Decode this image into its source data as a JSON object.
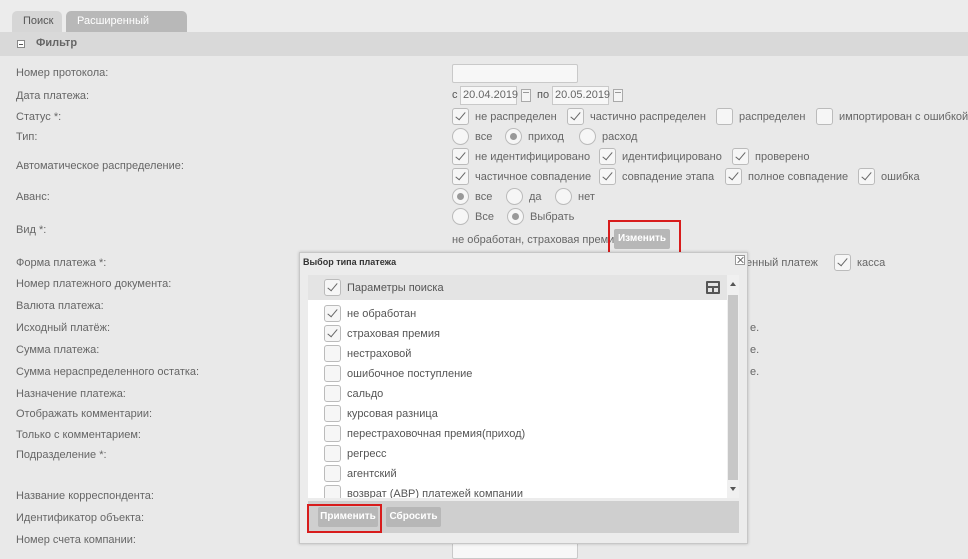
{
  "tabs": [
    "Поиск",
    "Расширенный поиск"
  ],
  "filter_title": "Фильтр",
  "labels": [
    "Номер протокола:",
    "Дата платежа:",
    "Статус *:",
    "Тип:",
    "Автоматическое распределение:",
    "Аванс:",
    "Вид *:",
    "Форма платежа *:",
    "Номер платежного документа:",
    "Валюта платежа:",
    "Исходный платёж:",
    "Сумма платежа:",
    "Сумма нераспределенного остатка:",
    "Назначение платежа:",
    "Отображать комментарии:",
    "Только с комментарием:",
    "Подразделение *:",
    "Название корреспондента:",
    "Идентификатор объекта:",
    "Номер счета компании:"
  ],
  "date": {
    "from_prefix": "с",
    "from": "20.04.2019",
    "to_prefix": "по",
    "to": "20.05.2019"
  },
  "status_options": [
    {
      "label": "не распределен",
      "checked": true
    },
    {
      "label": "частично распределен",
      "checked": true
    },
    {
      "label": "распределен",
      "checked": false
    },
    {
      "label": "импортирован с ошибкой",
      "checked": false
    }
  ],
  "type_options": [
    {
      "label": "все",
      "selected": false
    },
    {
      "label": "приход",
      "selected": true
    },
    {
      "label": "расход",
      "selected": false
    }
  ],
  "auto_row1": [
    {
      "label": "не идентифицировано",
      "checked": true
    },
    {
      "label": "идентифицировано",
      "checked": true
    },
    {
      "label": "проверено",
      "checked": true
    }
  ],
  "auto_row2": [
    {
      "label": "частичное совпадение",
      "checked": true
    },
    {
      "label": "совпадение этапа",
      "checked": true
    },
    {
      "label": "полное совпадение",
      "checked": true
    },
    {
      "label": "ошибка",
      "checked": true
    }
  ],
  "advance_options": [
    {
      "label": "все",
      "selected": true
    },
    {
      "label": "да",
      "selected": false
    },
    {
      "label": "нет",
      "selected": false
    }
  ],
  "kind_options": [
    {
      "label": "Все",
      "selected": false
    },
    {
      "label": "Выбрать",
      "selected": true
    }
  ],
  "kind_value": "не обработан, страховая премия",
  "change_button": "Изменить",
  "payment_form": {
    "partial_text": "енный платеж",
    "kassa": "касса"
  },
  "right_trunc": [
    "е.",
    "е.",
    "е."
  ],
  "dialog": {
    "title": "Выбор типа платежа",
    "header_label": "Параметры поиска",
    "items": [
      {
        "label": "не обработан",
        "checked": true
      },
      {
        "label": "страховая премия",
        "checked": true
      },
      {
        "label": "нестраховой",
        "checked": false
      },
      {
        "label": "ошибочное поступление",
        "checked": false
      },
      {
        "label": "сальдо",
        "checked": false
      },
      {
        "label": "курсовая разница",
        "checked": false
      },
      {
        "label": "перестраховочная премия(приход)",
        "checked": false
      },
      {
        "label": "регресс",
        "checked": false
      },
      {
        "label": "агентский",
        "checked": false
      },
      {
        "label": "возврат (АВР) платежей компании",
        "checked": false
      }
    ],
    "apply_button": "Применить",
    "reset_button": "Сбросить"
  },
  "colors": {
    "highlight": "#d81c1c",
    "button": "#b7b7b7",
    "background": "#e9e9e9"
  }
}
